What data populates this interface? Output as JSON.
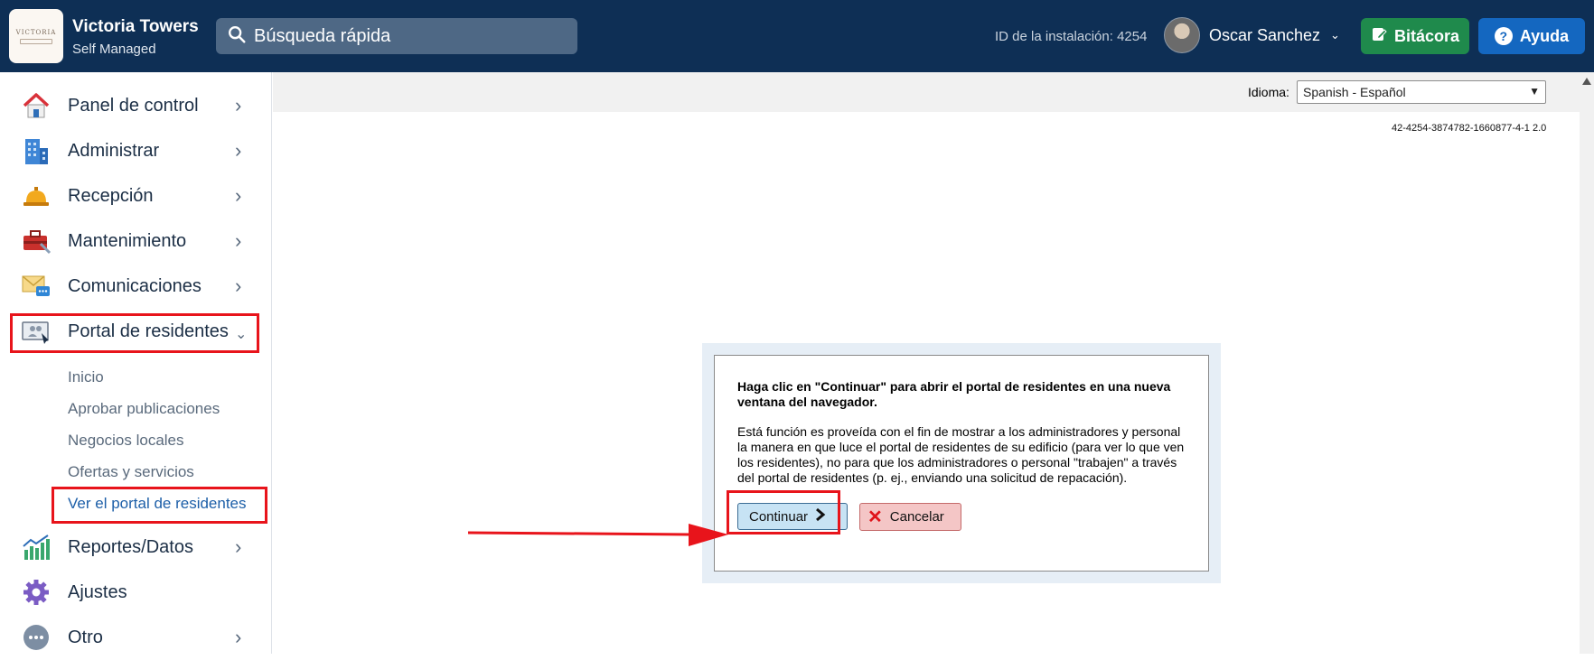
{
  "header": {
    "logo_text": "VICTORIA",
    "org_name": "Victoria Towers",
    "org_sub": "Self Managed",
    "search_placeholder": "Búsqueda rápida",
    "installation_id": "ID de la instalación: 4254",
    "user_name": "Oscar Sanchez",
    "bitacora_label": "Bitácora",
    "help_label": "Ayuda",
    "colors": {
      "bar": "#0e2f55",
      "bitacora": "#1f8a4c",
      "help": "#1467c0"
    }
  },
  "sidebar": {
    "items": [
      {
        "label": "Panel de control",
        "icon": "house-icon"
      },
      {
        "label": "Administrar",
        "icon": "building-icon"
      },
      {
        "label": "Recepción",
        "icon": "bell-icon"
      },
      {
        "label": "Mantenimiento",
        "icon": "toolbox-icon"
      },
      {
        "label": "Comunicaciones",
        "icon": "mail-chat-icon"
      },
      {
        "label": "Portal de residentes",
        "icon": "portal-icon"
      },
      {
        "label": "Reportes/Datos",
        "icon": "chart-icon"
      },
      {
        "label": "Ajustes",
        "icon": "gear-icon"
      },
      {
        "label": "Otro",
        "icon": "more-icon"
      }
    ],
    "portal_subitems": [
      "Inicio",
      "Aprobar publicaciones",
      "Negocios locales",
      "Ofertas y servicios",
      "Ver el portal de residentes"
    ],
    "highlight_color": "#e8141b"
  },
  "content": {
    "language_label": "Idioma:",
    "language_value": "Spanish - Español",
    "ref_code": "42-4254-3874782-1660877-4-1 2.0",
    "dialog": {
      "title": "Haga clic en \"Continuar\" para abrir el portal de residentes en una nueva ventana del navegador.",
      "body": "Está función es proveída con el fin de mostrar a los administradores y personal la manera en que luce el portal de residentes de su edificio (para ver lo que ven los residentes), no para que los administradores o personal \"trabajen\" a través del portal de residentes (p. ej., enviando una solicitud de repacación).",
      "continue_label": "Continuar",
      "cancel_label": "Cancelar"
    }
  }
}
